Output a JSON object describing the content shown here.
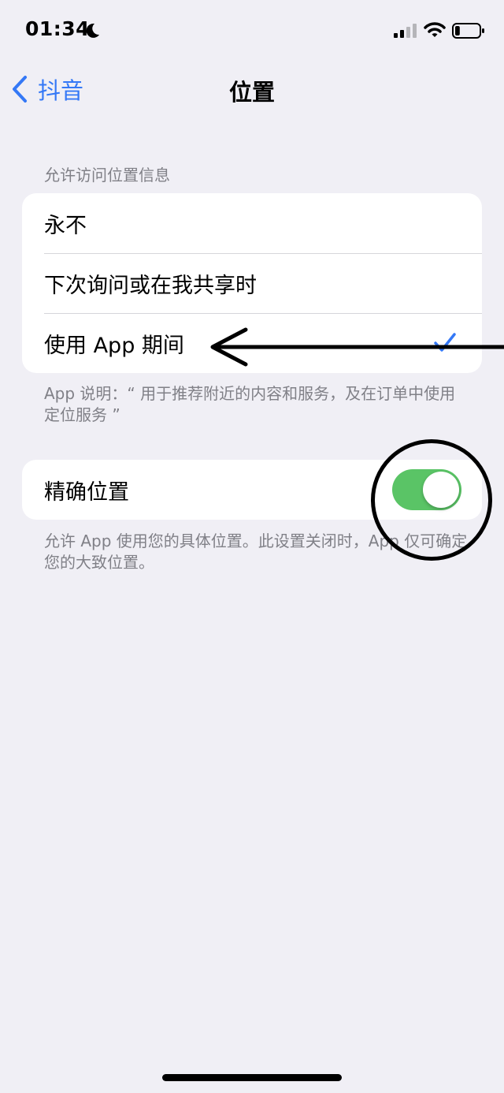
{
  "status_bar": {
    "time": "01:34",
    "moon_icon": "moon-icon",
    "signal_icon": "cellular-signal-icon",
    "wifi_icon": "wifi-icon",
    "battery_icon": "battery-icon",
    "battery_level": 0.2
  },
  "nav": {
    "back_label": "抖音",
    "title": "位置",
    "back_icon": "chevron-left-icon"
  },
  "location_access": {
    "header": "允许访问位置信息",
    "options": [
      {
        "label": "永不",
        "selected": false
      },
      {
        "label": "下次询问或在我共享时",
        "selected": false
      },
      {
        "label": "使用 App 期间",
        "selected": true
      }
    ],
    "footer": "App 说明：“ 用于推荐附近的内容和服务，及在订单中使用定位服务 ”"
  },
  "precise_location": {
    "label": "精确位置",
    "enabled": true,
    "footer": "允许 App 使用您的具体位置。此设置关闭时，App 仅可确定您的大致位置。"
  },
  "colors": {
    "accent": "#3478f6",
    "toggle_on": "#5ac466",
    "background": "#f0eff5",
    "secondary_text": "#808087"
  }
}
